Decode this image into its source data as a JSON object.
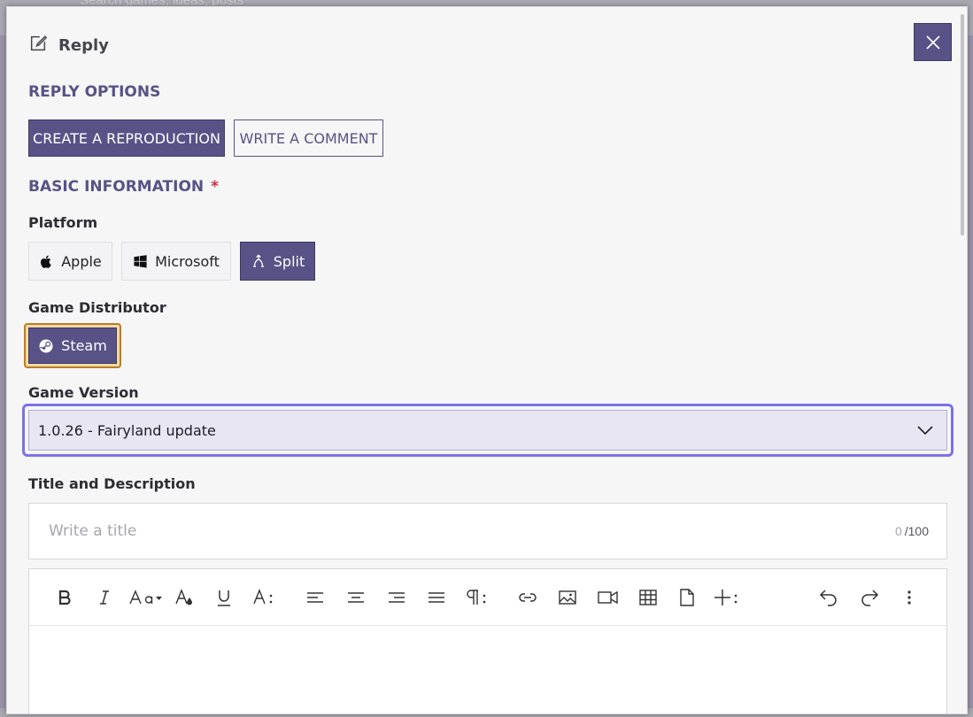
{
  "background": {
    "search_hint": "Search games, ideas, posts"
  },
  "modal": {
    "title": "Reply",
    "reply_options": {
      "heading": "REPLY OPTIONS",
      "create_label": "CREATE A REPRODUCTION",
      "comment_label": "WRITE A COMMENT"
    },
    "basic_info": {
      "heading": "BASIC INFORMATION",
      "required_mark": "*"
    },
    "platform": {
      "label": "Platform",
      "options": [
        {
          "label": "Apple",
          "icon": "apple-icon",
          "selected": false
        },
        {
          "label": "Microsoft",
          "icon": "windows-icon",
          "selected": false
        },
        {
          "label": "Split",
          "icon": "split-icon",
          "selected": true
        }
      ]
    },
    "distributor": {
      "label": "Game Distributor",
      "options": [
        {
          "label": "Steam",
          "icon": "steam-icon",
          "selected": true
        }
      ]
    },
    "version": {
      "label": "Game Version",
      "selected": "1.0.26 - Fairyland update"
    },
    "title_desc": {
      "label": "Title and Description",
      "title_placeholder": "Write a title",
      "count_current": "0",
      "count_max": "/100"
    }
  },
  "colors": {
    "accent": "#585287",
    "focus": "#7b72ea",
    "highlight": "#b97e24",
    "required": "#cc2d43"
  }
}
